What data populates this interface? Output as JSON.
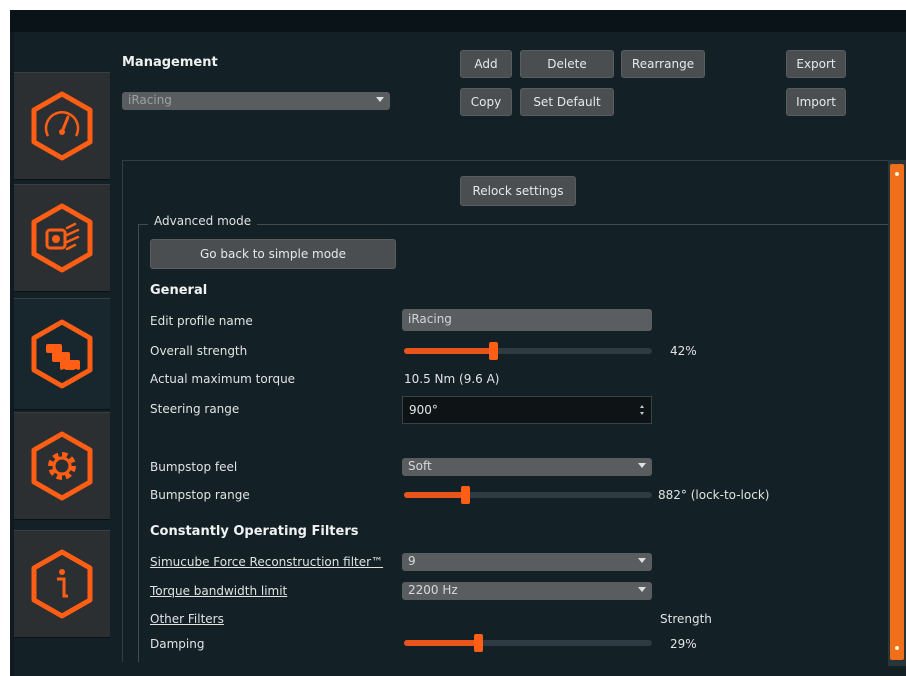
{
  "header": {
    "title": "Management",
    "profile_select": "iRacing",
    "buttons": {
      "add": "Add",
      "delete": "Delete",
      "rearrange": "Rearrange",
      "export": "Export",
      "copy": "Copy",
      "set_default": "Set Default",
      "import": "Import"
    }
  },
  "sidebar": {
    "items": [
      {
        "icon": "speedometer-icon"
      },
      {
        "icon": "wheel-base-icon"
      },
      {
        "icon": "cars-icon",
        "active": true
      },
      {
        "icon": "gear-icon"
      },
      {
        "icon": "info-icon"
      }
    ],
    "accent": "#ff5e14"
  },
  "panel": {
    "relock_label": "Relock settings",
    "group_title": "Advanced mode",
    "simple_mode_label": "Go back to simple mode",
    "general_heading": "General",
    "profile_name_label": "Edit profile name",
    "profile_name_value": "iRacing",
    "overall_strength_label": "Overall strength",
    "overall_strength_value": "42%",
    "overall_strength_fraction": 0.36,
    "max_torque_label": "Actual maximum torque",
    "max_torque_value": "10.5 Nm (9.6 A)",
    "steering_range_label": "Steering range",
    "steering_range_value": "900°",
    "bumpstop_feel_label": "Bumpstop feel",
    "bumpstop_feel_value": "Soft",
    "bumpstop_range_label": "Bumpstop range",
    "bumpstop_range_value": "882° (lock-to-lock)",
    "bumpstop_range_fraction": 0.245,
    "filters_heading": "Constantly Operating Filters",
    "reconstruction_label": "Simucube Force Reconstruction filter™",
    "reconstruction_value": "9",
    "bandwidth_label": "Torque bandwidth limit",
    "bandwidth_value": "2200 Hz",
    "other_filters_label": "Other Filters",
    "strength_header": "Strength",
    "damping_label": "Damping",
    "damping_value": "29%",
    "damping_fraction": 0.3
  }
}
